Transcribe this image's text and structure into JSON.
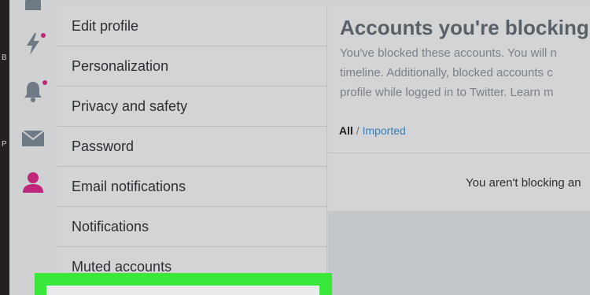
{
  "left_strip": {
    "letters": [
      "B",
      "P"
    ]
  },
  "rail": {
    "icons": [
      {
        "name": "home-icon"
      },
      {
        "name": "lightning-icon",
        "notification": true
      },
      {
        "name": "bell-icon",
        "notification": true
      },
      {
        "name": "mail-icon"
      },
      {
        "name": "profile-icon",
        "active": true
      }
    ],
    "icon_color": "#6f7a84",
    "active_color": "#c0267a"
  },
  "settings_menu": {
    "items": [
      {
        "label": "Edit profile"
      },
      {
        "label": "Personalization"
      },
      {
        "label": "Privacy and safety"
      },
      {
        "label": "Password"
      },
      {
        "label": "Email notifications"
      },
      {
        "label": "Notifications"
      },
      {
        "label": "Muted accounts"
      }
    ]
  },
  "highlight_color": "#39e83a",
  "content": {
    "title": "Accounts you're blocking",
    "description_lines": [
      "You've blocked these accounts. You will n",
      "timeline. Additionally, blocked accounts c",
      "profile while logged in to Twitter. Learn m"
    ],
    "filter": {
      "all": "All",
      "separator": "/",
      "imported": "Imported"
    },
    "empty_message": "You aren't blocking an"
  }
}
